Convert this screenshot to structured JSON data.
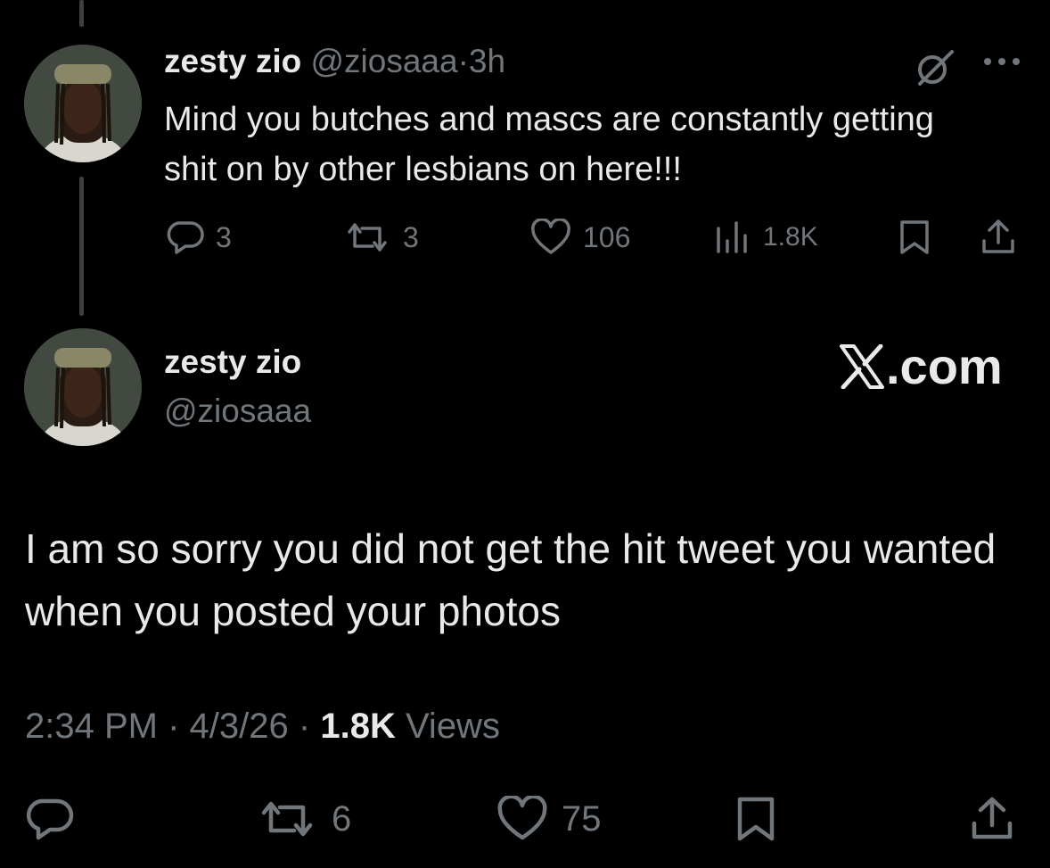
{
  "reply_context": {
    "display_name": "zesty zio",
    "handle": "@ziosaaa",
    "separator": "·",
    "time": "3h",
    "text": "Mind you butches and mascs are constantly getting shit on by other lesbians on here!!!",
    "actions": {
      "reply_count": "3",
      "repost_count": "3",
      "like_count": "106",
      "views_count": "1.8K"
    },
    "icons": [
      "reply-icon",
      "repost-icon",
      "like-icon",
      "views-icon",
      "bookmark-icon",
      "share-icon",
      "grok-icon",
      "more-icon"
    ]
  },
  "main_tweet": {
    "display_name": "zesty zio",
    "handle": "@ziosaaa",
    "watermark": ".com",
    "text": "I am so sorry you did not get the hit tweet you wanted when you posted your photos",
    "time": "2:34 PM",
    "sep1": "·",
    "date": "4/3/26",
    "sep2": "·",
    "views_count": "1.8K",
    "views_label": "Views",
    "actions": {
      "repost_count": "6",
      "like_count": "75"
    }
  },
  "colors": {
    "background": "#000000",
    "text_primary": "#e7e9ea",
    "text_muted": "#71767b",
    "thread_line": "#3b3f43"
  }
}
